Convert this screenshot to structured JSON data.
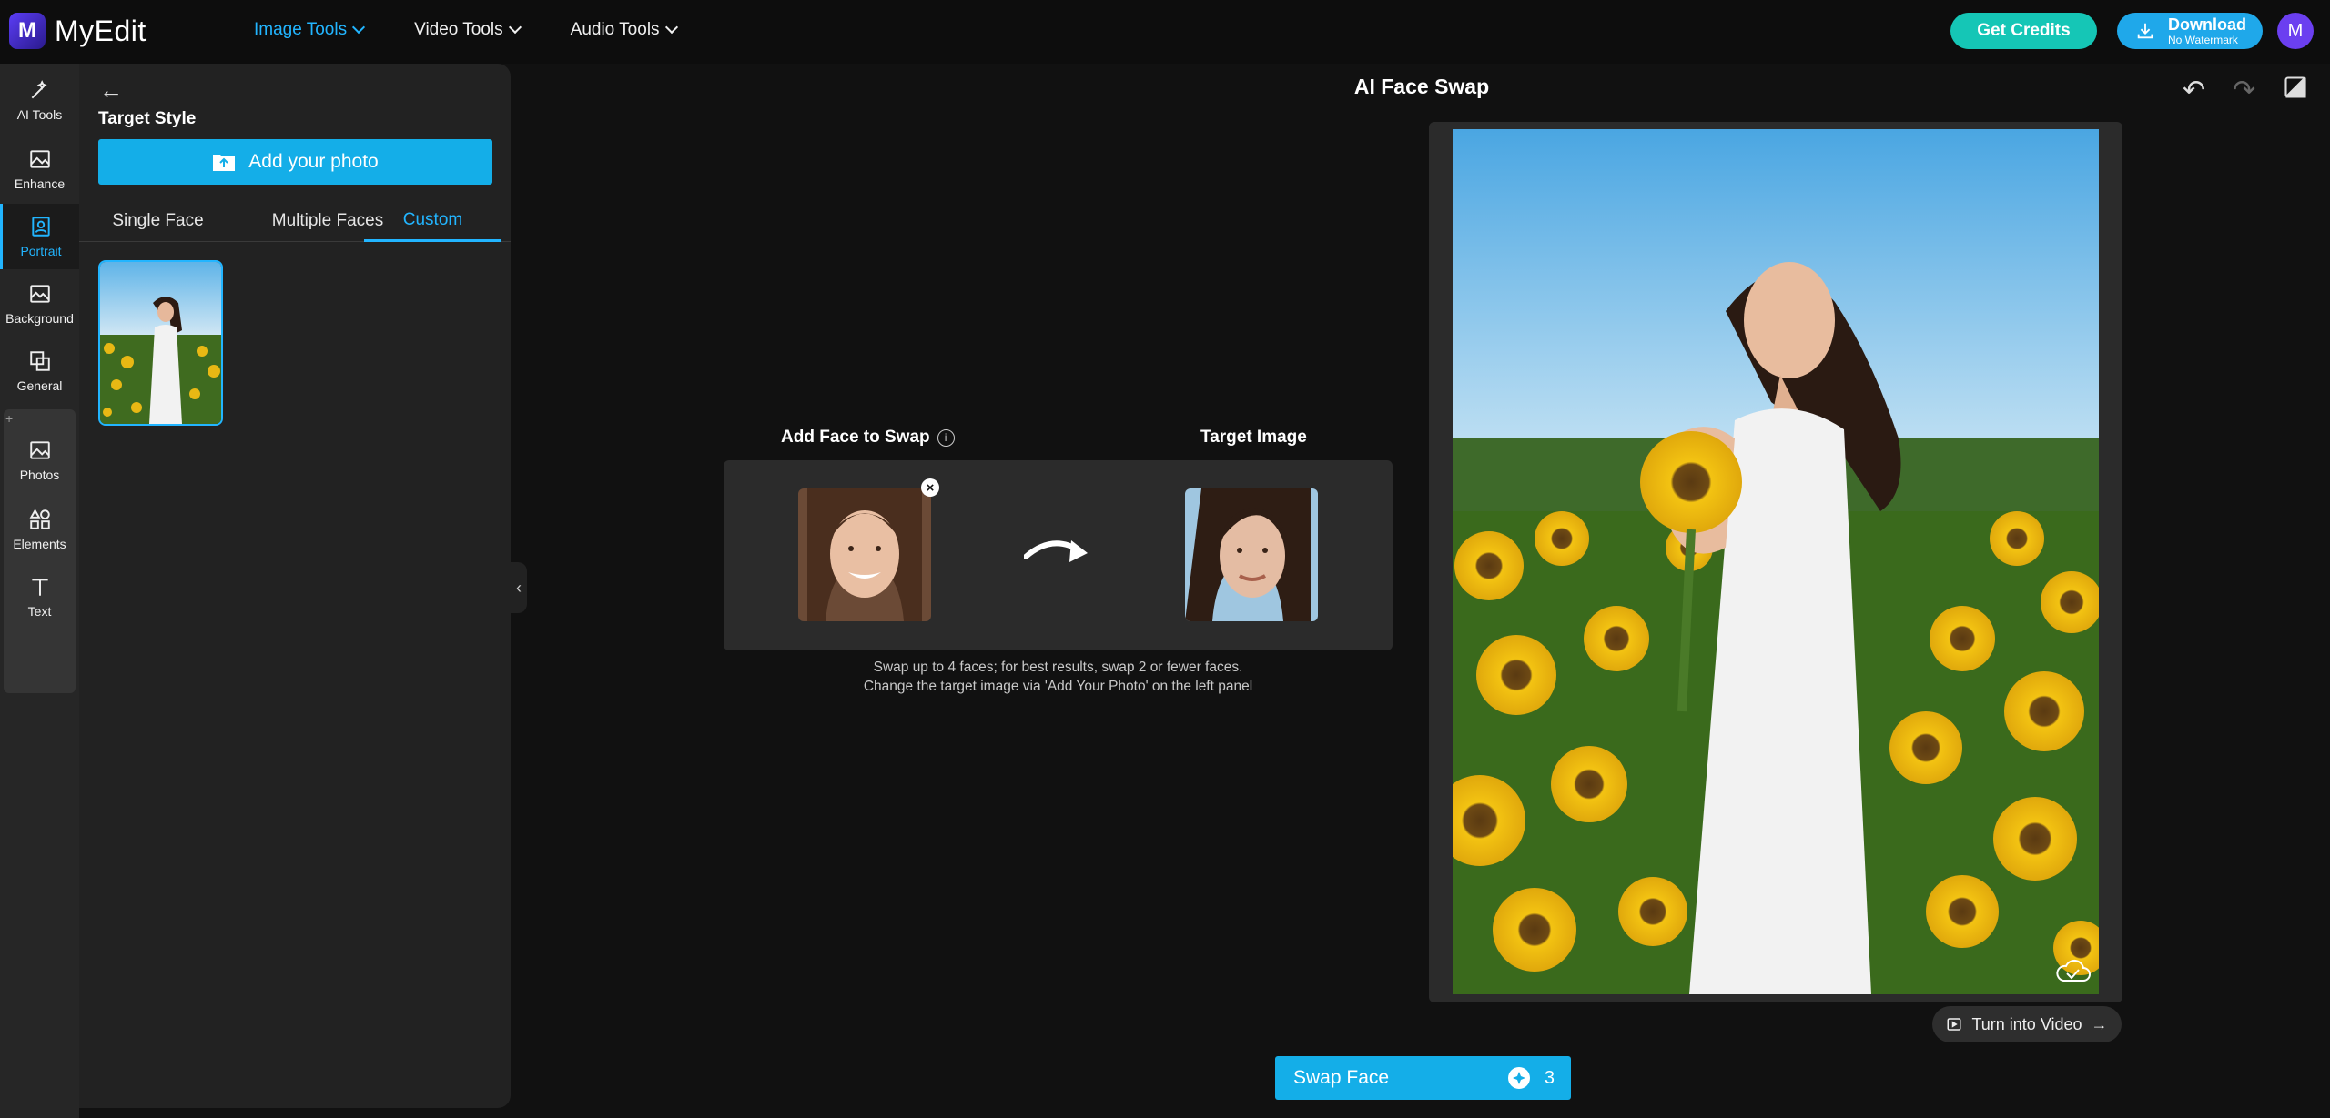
{
  "app": {
    "name": "MyEdit",
    "logo_letter": "M"
  },
  "nav": [
    {
      "label": "Image Tools",
      "active": true
    },
    {
      "label": "Video Tools",
      "active": false
    },
    {
      "label": "Audio Tools",
      "active": false
    }
  ],
  "header": {
    "get_credits": "Get Credits",
    "download_main": "Download",
    "download_sub": "No Watermark",
    "avatar_letter": "M"
  },
  "rail": [
    {
      "label": "AI Tools",
      "icon": "magic-wand-icon"
    },
    {
      "label": "Enhance",
      "icon": "enhance-icon"
    },
    {
      "label": "Portrait",
      "icon": "portrait-icon",
      "active": true
    },
    {
      "label": "Background",
      "icon": "background-icon"
    },
    {
      "label": "General",
      "icon": "general-icon"
    },
    {
      "label": "Photos",
      "icon": "photos-icon"
    },
    {
      "label": "Elements",
      "icon": "elements-icon"
    },
    {
      "label": "Text",
      "icon": "text-icon"
    }
  ],
  "panel": {
    "title": "Target Style",
    "add_photo": "Add your photo",
    "tabs": [
      {
        "label": "Single Face"
      },
      {
        "label": "Multiple Faces"
      },
      {
        "label": "Custom",
        "active": true
      }
    ]
  },
  "editor": {
    "heading": "AI Face Swap",
    "face_label": "Add Face to Swap",
    "target_label": "Target Image",
    "hint_line1": "Swap up to 4 faces; for best results, swap 2 or fewer faces.",
    "hint_line2": "Change the target image via 'Add Your Photo' on the left panel",
    "turn_video": "Turn into Video",
    "swap_button": "Swap Face",
    "credits_cost": "3"
  },
  "colors": {
    "accent": "#14aee8",
    "credits_button": "#15c6b6",
    "avatar": "#6b3ff0"
  }
}
